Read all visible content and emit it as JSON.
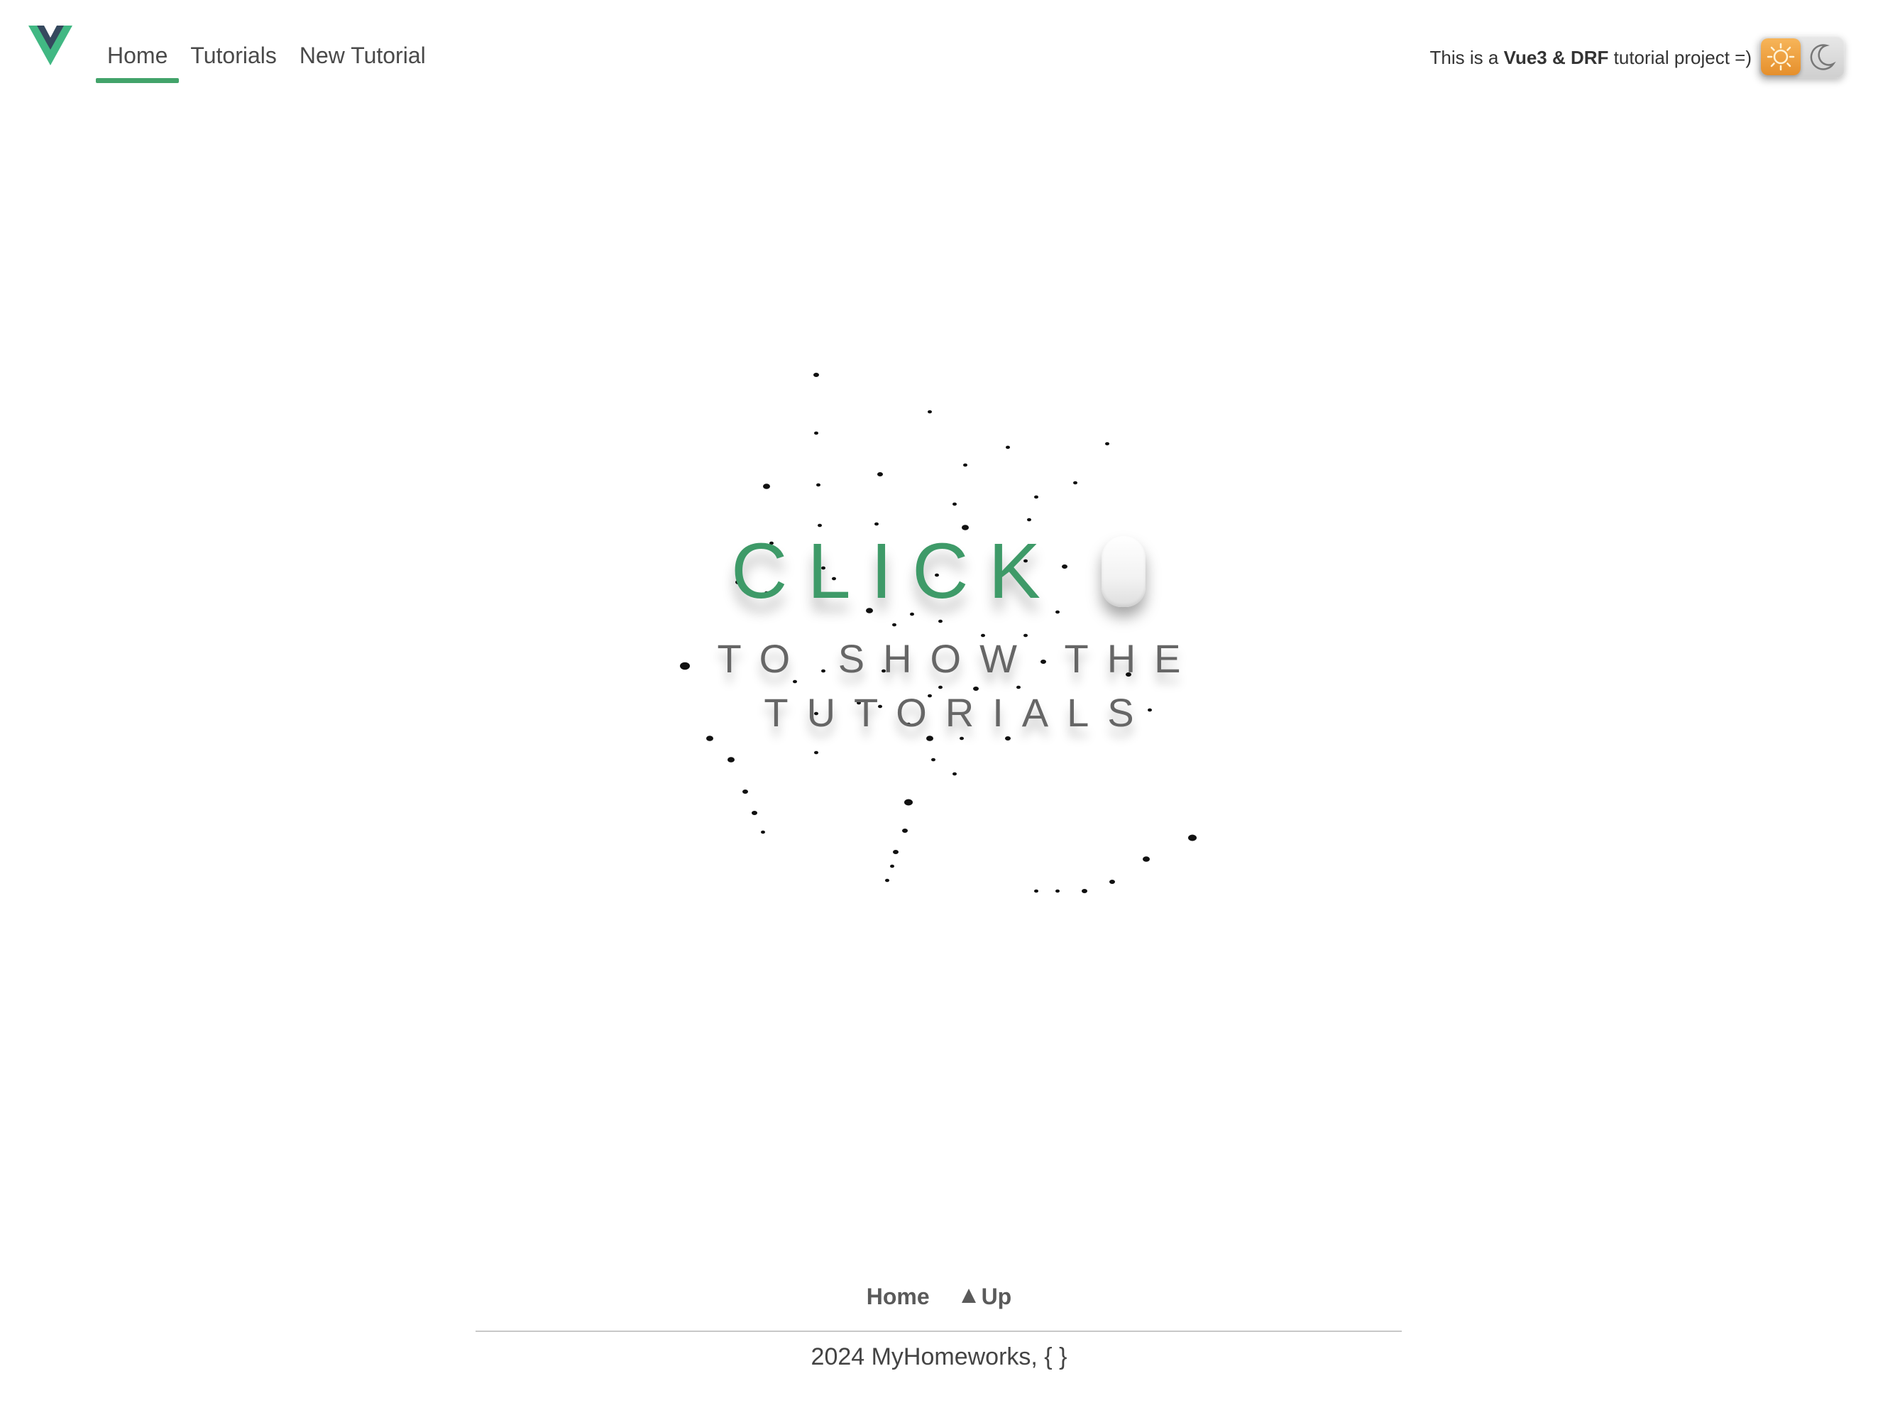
{
  "header": {
    "logo_name": "vue-logo",
    "nav": [
      {
        "label": "Home",
        "active": true
      },
      {
        "label": "Tutorials",
        "active": false
      },
      {
        "label": "New Tutorial",
        "active": false
      }
    ],
    "tagline_prefix": "This is a ",
    "tagline_bold": "Vue3 & DRF",
    "tagline_suffix": " tutorial project =)",
    "theme_toggle": {
      "state": "light",
      "icons": [
        "sun-icon",
        "moon-icon"
      ]
    }
  },
  "hero": {
    "click_label": "CLICK",
    "line1": "TO SHOW THE",
    "line2": "TUTORIALS",
    "mouse_icon": "mouse-icon"
  },
  "footer": {
    "home_label": "Home",
    "up_label": "Up",
    "copyright": "2024 MyHomeworks, { }"
  },
  "colors": {
    "accent": "#42a36a",
    "text": "#4a4a4a",
    "toggle_sun": "#f0a040"
  }
}
